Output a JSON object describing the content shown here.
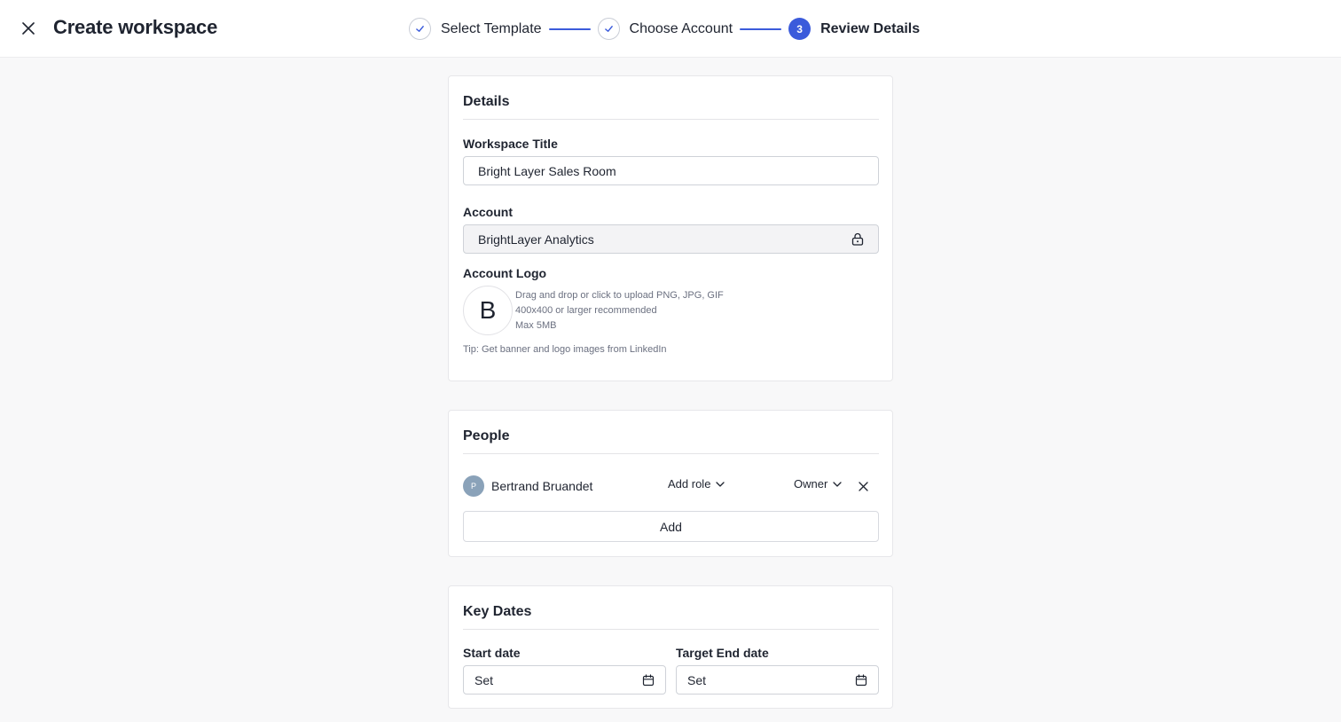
{
  "header": {
    "title": "Create workspace",
    "steps": [
      {
        "label": "Select Template",
        "state": "done"
      },
      {
        "label": "Choose Account",
        "state": "done"
      },
      {
        "label": "Review Details",
        "state": "active",
        "number": "3"
      }
    ]
  },
  "details": {
    "heading": "Details",
    "workspace_title_label": "Workspace Title",
    "workspace_title_value": "Bright Layer Sales Room",
    "account_label": "Account",
    "account_value": "BrightLayer Analytics",
    "logo_label": "Account Logo",
    "logo_letter": "B",
    "upload_hint_1": "Drag and drop or click to upload PNG, JPG, GIF",
    "upload_hint_2": "400x400 or larger recommended",
    "upload_hint_3": "Max 5MB",
    "tip": "Tip: Get banner and logo images from LinkedIn"
  },
  "people": {
    "heading": "People",
    "members": [
      {
        "initial": "P",
        "name": "Bertrand Bruandet",
        "role": "Add role",
        "permission": "Owner"
      }
    ],
    "add_label": "Add"
  },
  "key_dates": {
    "heading": "Key Dates",
    "start_label": "Start date",
    "start_value": "Set",
    "end_label": "Target End date",
    "end_value": "Set"
  },
  "colors": {
    "accent": "#3b5bdb",
    "avatar": "#8aa2b9",
    "page_bg": "#f8f8f9"
  },
  "icons": [
    "close-icon",
    "check-icon",
    "lock-icon",
    "chevron-down-icon",
    "calendar-icon"
  ]
}
